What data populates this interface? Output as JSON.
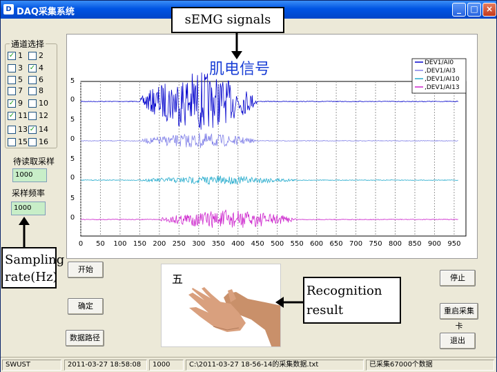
{
  "window": {
    "title": "DAQ采集系统"
  },
  "channels": {
    "group_label": "通道选择",
    "items": [
      {
        "label": "1",
        "checked": true
      },
      {
        "label": "2",
        "checked": false
      },
      {
        "label": "3",
        "checked": false
      },
      {
        "label": "4",
        "checked": true
      },
      {
        "label": "5",
        "checked": false
      },
      {
        "label": "6",
        "checked": false
      },
      {
        "label": "7",
        "checked": false
      },
      {
        "label": "8",
        "checked": false
      },
      {
        "label": "9",
        "checked": true
      },
      {
        "label": "10",
        "checked": false
      },
      {
        "label": "11",
        "checked": true
      },
      {
        "label": "12",
        "checked": false
      },
      {
        "label": "13",
        "checked": false
      },
      {
        "label": "14",
        "checked": true
      },
      {
        "label": "15",
        "checked": false
      },
      {
        "label": "16",
        "checked": false
      }
    ]
  },
  "samples_to_read": {
    "label": "待读取采样",
    "value": "1000"
  },
  "sample_rate": {
    "label": "采样频率",
    "value": "1000"
  },
  "buttons": {
    "start": "开始",
    "confirm": "确定",
    "data_path": "数据路径",
    "stop": "停止",
    "restart_card": "重启采集卡",
    "exit": "退出"
  },
  "recognition": {
    "char": "五"
  },
  "annotations": {
    "semg": "sEMG signals",
    "sampling_line1": "Sampling",
    "sampling_line2": "rate(Hz)",
    "recognition_line1": "Recognition",
    "recognition_line2": "result"
  },
  "status": {
    "org": "SWUST",
    "datetime": "2011-03-27  18:58:08",
    "rate": "1000",
    "file": "C:\\2011-03-27 18-56-14的采集数据.txt",
    "count": "已采集67000个数据"
  },
  "colors": {
    "ch0": "#0000cc",
    "ch3": "#8080e8",
    "ch10": "#22aacc",
    "ch13": "#cc22cc",
    "title_blue": "#1a3fd6"
  },
  "chart_data": {
    "type": "line",
    "title": "肌电信号",
    "xlim": [
      0,
      980
    ],
    "xticks": [
      0,
      50,
      100,
      150,
      200,
      250,
      300,
      350,
      400,
      450,
      500,
      550,
      600,
      650,
      700,
      750,
      800,
      850,
      900,
      950
    ],
    "ytick_labels": [
      "5",
      "0",
      "5",
      "0",
      "5",
      "0",
      "5",
      "0"
    ],
    "grid": true,
    "legend_position": "top-right",
    "series": [
      {
        "name": "DEV1/AI0",
        "color": "#0000cc",
        "active_range": [
          150,
          450
        ],
        "amplitude": 5
      },
      {
        "name": ",DEV1/AI3",
        "color": "#8080e8",
        "active_range": [
          150,
          450
        ],
        "amplitude": 2.2
      },
      {
        "name": ",DEV1/AI10",
        "color": "#22aacc",
        "active_range": [
          150,
          550
        ],
        "amplitude": 1.2
      },
      {
        "name": ",DEV1/AI13",
        "color": "#cc22cc",
        "active_range": [
          200,
          550
        ],
        "amplitude": 2.8
      }
    ]
  }
}
